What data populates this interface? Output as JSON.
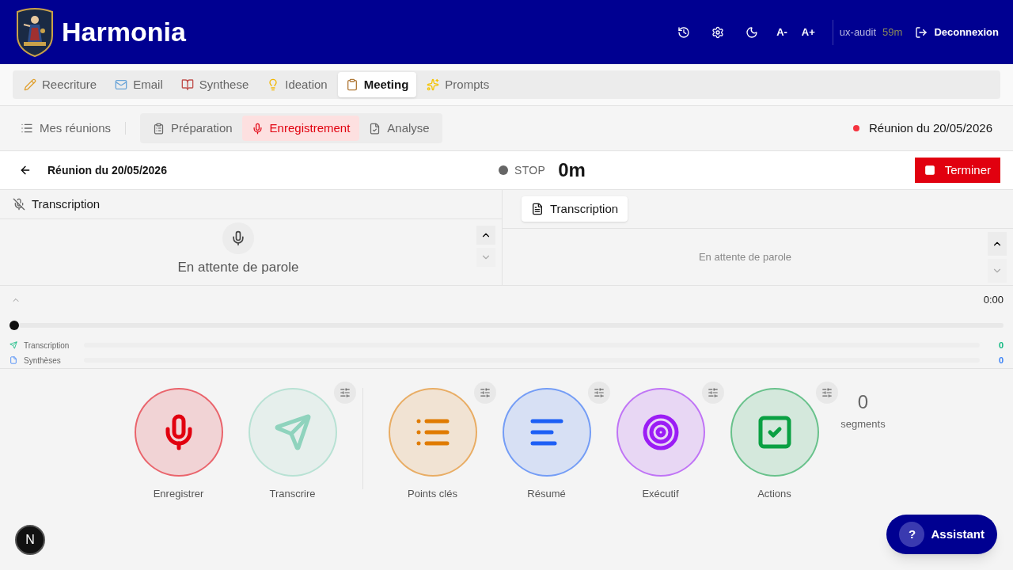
{
  "header": {
    "app_name": "Harmonia",
    "font_decrease": "A-",
    "font_increase": "A+",
    "user": "ux-audit",
    "session_time": "59m",
    "logout": "Deconnexion"
  },
  "tabs": [
    {
      "label": "Reecriture",
      "selected": false
    },
    {
      "label": "Email",
      "selected": false
    },
    {
      "label": "Synthese",
      "selected": false
    },
    {
      "label": "Ideation",
      "selected": false
    },
    {
      "label": "Meeting",
      "selected": true
    },
    {
      "label": "Prompts",
      "selected": false
    }
  ],
  "subnav": {
    "my_meetings": "Mes réunions",
    "steps": [
      {
        "label": "Préparation",
        "selected": false
      },
      {
        "label": "Enregistrement",
        "selected": true
      },
      {
        "label": "Analyse",
        "selected": false
      }
    ],
    "current_meeting": "Réunion du 20/05/2026"
  },
  "toolbar": {
    "title": "Réunion du 20/05/2026",
    "status": "STOP",
    "duration": "0m",
    "finish": "Terminer"
  },
  "left_panel": {
    "title": "Transcription",
    "message": "En attente de parole"
  },
  "right_panel": {
    "tab": "Transcription",
    "message": "En attente de parole"
  },
  "timeline": {
    "time": "0:00",
    "level": 0,
    "tracks": [
      {
        "label": "Transcription",
        "count": "0",
        "color": "#10b981"
      },
      {
        "label": "Synthèses",
        "count": "0",
        "color": "#3b82f6"
      }
    ]
  },
  "actions": [
    {
      "label": "Enregistrer",
      "color": "#e1000f",
      "settings": false
    },
    {
      "label": "Transcrire",
      "color": "#8fd3bd",
      "settings": true
    },
    {
      "label": "Points clés",
      "color": "#e07b00",
      "settings": true
    },
    {
      "label": "Résumé",
      "color": "#1d5ff5",
      "settings": true
    },
    {
      "label": "Exécutif",
      "color": "#9b1df5",
      "settings": true
    },
    {
      "label": "Actions",
      "color": "#0aa043",
      "settings": true
    }
  ],
  "segments": {
    "count": "0",
    "label": "segments"
  },
  "assistant": {
    "label": "Assistant",
    "icon_text": "?"
  },
  "dev_badge": "N"
}
